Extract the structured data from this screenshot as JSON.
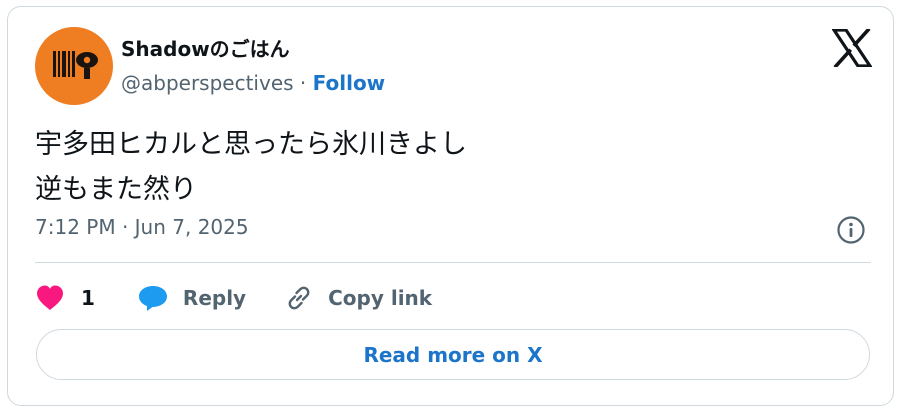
{
  "author": {
    "display_name": "Shadowのごはん",
    "handle": "@abperspectives",
    "separator": " · ",
    "follow_label": "Follow",
    "avatar_color": "#ef7d22"
  },
  "tweet": {
    "lines": [
      "宇多田ヒカルと思ったら氷川きよし",
      "逆もまた然り"
    ],
    "timestamp": "7:12 PM · Jun 7, 2025"
  },
  "actions": {
    "like_count": "1",
    "reply_label": "Reply",
    "copy_label": "Copy link"
  },
  "read_more_label": "Read more on X",
  "icons": {
    "brand": "x-logo-icon",
    "info": "info-icon",
    "like": "heart-icon",
    "reply": "speech-bubble-icon",
    "copy": "link-icon"
  },
  "colors": {
    "heart": "#f91880",
    "reply": "#1d9bf0",
    "link_blue": "#1d75c9",
    "muted": "#536471",
    "text": "#0f1419",
    "border": "#cfd9de"
  }
}
